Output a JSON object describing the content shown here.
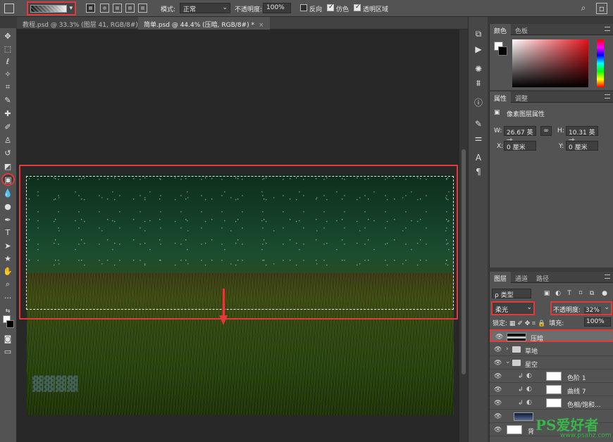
{
  "options_bar": {
    "mode_label": "模式:",
    "mode_value": "正常",
    "opacity_label": "不透明度:",
    "opacity_value": "100%",
    "reverse_label": "反向",
    "dither_label": "仿色",
    "transparency_label": "透明区域",
    "reverse_checked": false,
    "dither_checked": true,
    "transparency_checked": true
  },
  "tabs": [
    {
      "label": "教程.psd @ 33.3% (图层 41, RGB/8#)",
      "active": false
    },
    {
      "label": "简单.psd @ 44.4% (压暗, RGB/8#) *",
      "active": true
    }
  ],
  "tab_close": "×",
  "color_panel": {
    "tabs": [
      "颜色",
      "色板"
    ],
    "accent_red": "#e3121b"
  },
  "properties_panel": {
    "tabs": [
      "属性",
      "调整"
    ],
    "title": "像素图层属性",
    "w_label": "W:",
    "w_value": "26.67 英寸",
    "h_label": "H:",
    "h_value": "10.31 英寸",
    "x_label": "X:",
    "x_value": "0 厘米",
    "y_label": "Y:",
    "y_value": "0 厘米"
  },
  "layers_panel": {
    "tabs": [
      "图层",
      "通道",
      "路径"
    ],
    "filter_label": "ρ 类型",
    "blend_mode": "柔光",
    "opacity_label": "不透明度:",
    "opacity_value": "32%",
    "lock_label": "锁定:",
    "fill_label": "填充:",
    "fill_value": "100%",
    "layers": [
      {
        "name": "压暗",
        "kind": "pixel",
        "selected": true
      },
      {
        "name": "草地",
        "kind": "group-collapsed"
      },
      {
        "name": "星空",
        "kind": "group-expanded"
      },
      {
        "name": "色阶 1",
        "kind": "adjustment"
      },
      {
        "name": "曲线 7",
        "kind": "adjustment"
      },
      {
        "name": "色相/饱和...",
        "kind": "adjustment"
      },
      {
        "name": "",
        "kind": "pixel-dark"
      },
      {
        "name": "背",
        "kind": "background"
      }
    ]
  },
  "watermark": {
    "brand": "PS爱好者",
    "url": "www.psahz.com"
  },
  "highlight_color": "#e23a3a"
}
